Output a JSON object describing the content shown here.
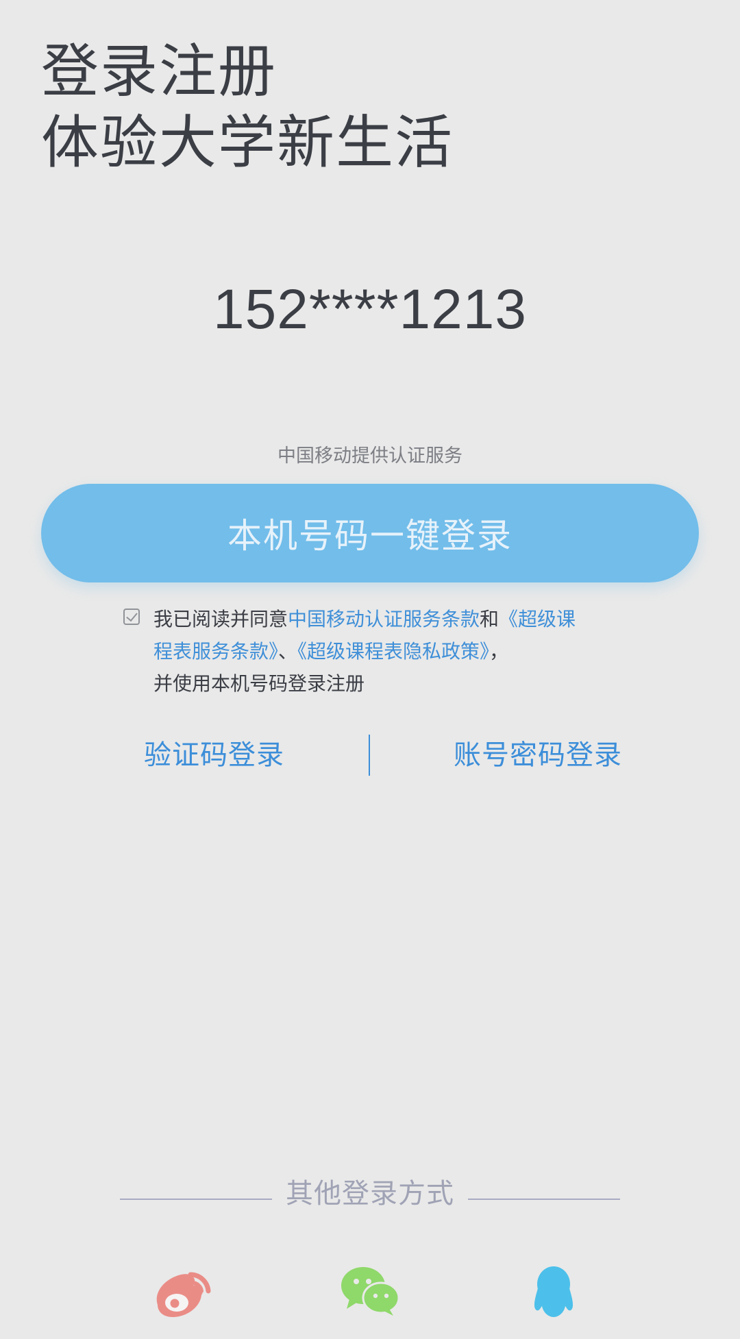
{
  "header": {
    "title_line1": "登录注册",
    "title_line2": "体验大学新生活"
  },
  "login": {
    "masked_phone": "152****1213",
    "provider_note": "中国移动提供认证服务",
    "one_click_button": "本机号码一键登录"
  },
  "agreement": {
    "checked": true,
    "prefix": "我已阅读并同意",
    "link_cmcc": "中国移动认证服务条款",
    "and": "和",
    "link_service": "《超级课程表服务条款》",
    "separator": "、",
    "link_privacy": "《超级课程表隐私政策》",
    "comma": "，",
    "suffix": "并使用本机号码登录注册"
  },
  "alternatives": {
    "sms_login": "验证码登录",
    "password_login": "账号密码登录"
  },
  "other_methods": {
    "label": "其他登录方式",
    "icons": [
      "weibo-icon",
      "wechat-icon",
      "qq-icon"
    ]
  },
  "colors": {
    "background": "#e9e9e9",
    "primary_button": "#72bdea",
    "link": "#3f8fd8",
    "weibo": "#ea8c86",
    "wechat": "#8fd86a",
    "qq": "#4cc0ea"
  }
}
